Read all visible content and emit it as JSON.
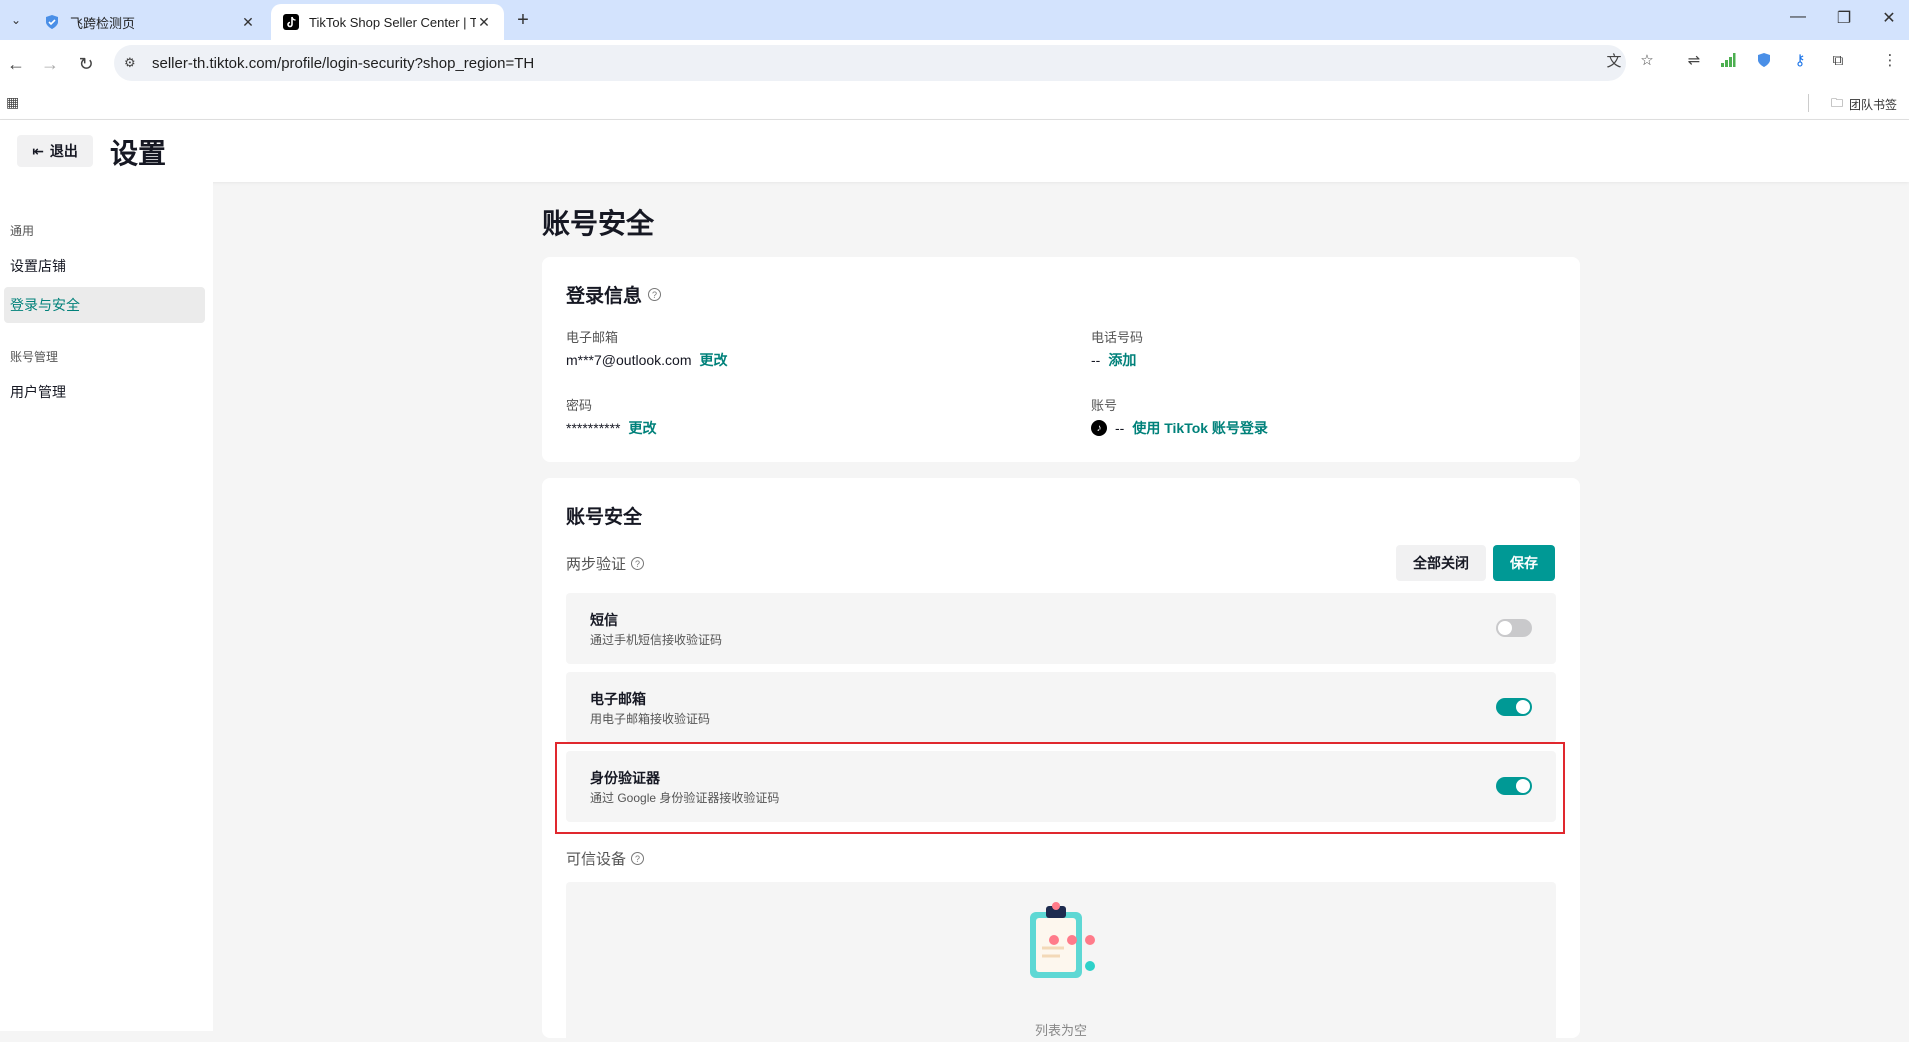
{
  "browser": {
    "tabs": [
      {
        "label": "飞跨检测页",
        "active": false
      },
      {
        "label": "TikTok Shop Seller Center | TI",
        "active": true
      }
    ],
    "url": "seller-th.tiktok.com/profile/login-security?shop_region=TH",
    "bookmark_folder": "团队书签"
  },
  "header": {
    "exit_label": "退出",
    "title": "设置"
  },
  "sidebar": {
    "groups": [
      {
        "label": "通用",
        "items": [
          {
            "label": "设置店铺",
            "active": false
          },
          {
            "label": "登录与安全",
            "active": true
          }
        ]
      },
      {
        "label": "账号管理",
        "items": [
          {
            "label": "用户管理",
            "active": false
          }
        ]
      }
    ]
  },
  "main": {
    "title": "账号安全",
    "login_info": {
      "title": "登录信息",
      "email_label": "电子邮箱",
      "email_value": "m***7@outlook.com",
      "email_action": "更改",
      "phone_label": "电话号码",
      "phone_value": "--",
      "phone_action": "添加",
      "password_label": "密码",
      "password_value": "**********",
      "password_action": "更改",
      "account_label": "账号",
      "account_value": "--",
      "account_action": "使用 TikTok 账号登录"
    },
    "security": {
      "title": "账号安全",
      "two_step_label": "两步验证",
      "close_all_label": "全部关闭",
      "save_label": "保存",
      "methods": [
        {
          "title": "短信",
          "desc": "通过手机短信接收验证码",
          "enabled": false
        },
        {
          "title": "电子邮箱",
          "desc": "用电子邮箱接收验证码",
          "enabled": true
        },
        {
          "title": "身份验证器",
          "desc": "通过 Google 身份验证器接收验证码",
          "enabled": true
        }
      ],
      "trusted_devices_label": "可信设备",
      "empty_text": "列表为空"
    }
  },
  "colors": {
    "accent": "#009995",
    "link": "#00817a",
    "highlight": "#e0282e"
  }
}
